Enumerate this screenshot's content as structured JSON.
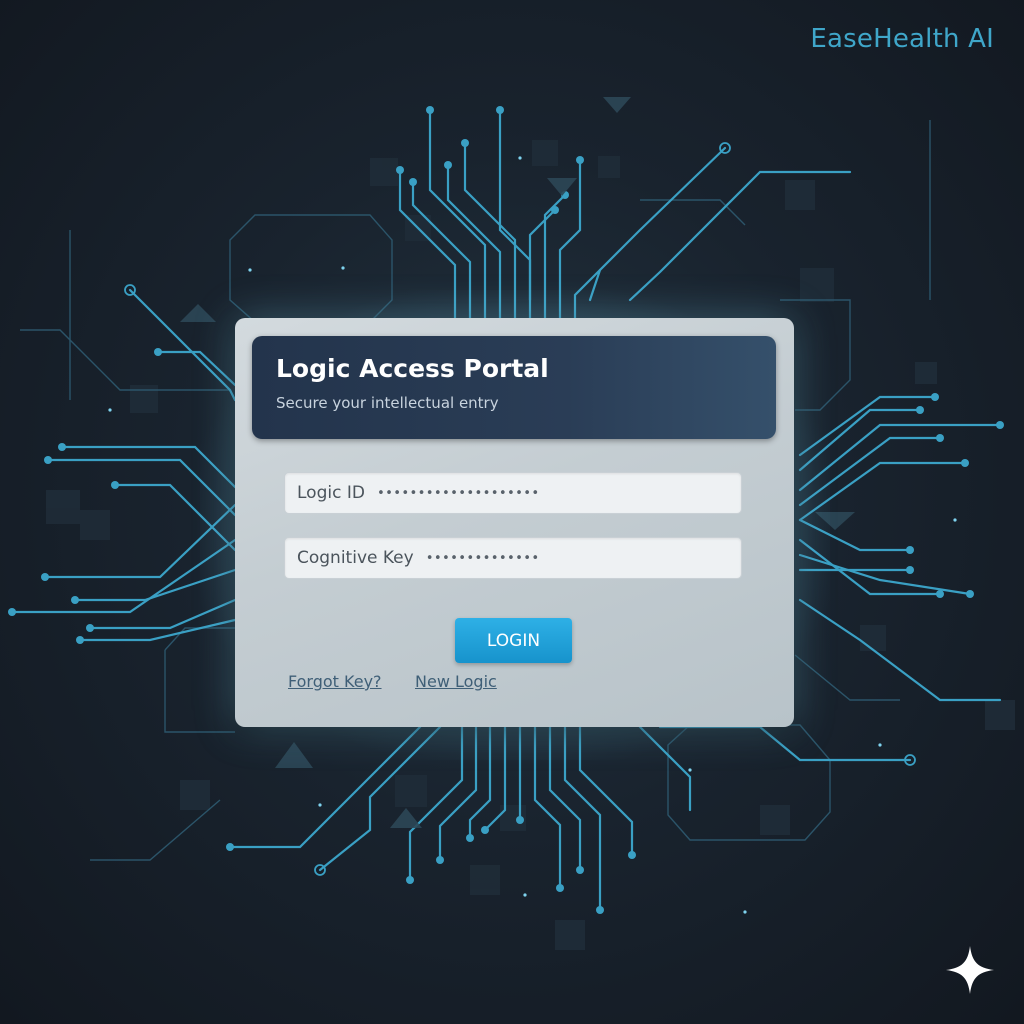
{
  "brand": {
    "name": "EaseHealth AI"
  },
  "login_card": {
    "title": "Logic Access Portal",
    "subtitle": "Secure your intellectual entry",
    "fields": [
      {
        "label": "Logic ID",
        "value": "••••••••••••••••••••"
      },
      {
        "label": "Cognitive Key",
        "value": "••••••••••••••"
      }
    ],
    "login_button": "LOGIN",
    "links": {
      "forgot": "Forgot Key?",
      "new": "New Logic"
    }
  },
  "decor": {
    "background_icon": "circuit-board-pattern",
    "corner_icon": "sparkle-icon"
  },
  "colors": {
    "background": "#141b24",
    "circuit_line": "#3aa0c4",
    "accent_button": "#1ea3da",
    "brand_text": "#3fa6c9",
    "card_header": "#23344c"
  }
}
